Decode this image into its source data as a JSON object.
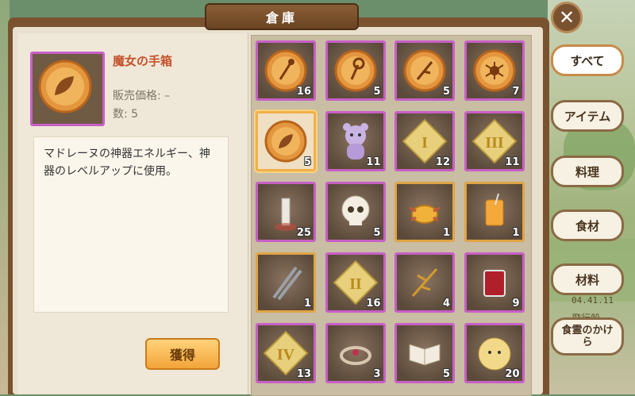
{
  "window": {
    "title": "倉庫"
  },
  "selected_item": {
    "name": "魔女の手箱",
    "price": "販売価格: –",
    "count": "数: 5",
    "description": "マドレーヌの神器エネルギー、神器のレベルアップに使用。",
    "obtain_label": "獲得"
  },
  "tabs": [
    {
      "label": "すべて",
      "active": true
    },
    {
      "label": "アイテム",
      "active": false
    },
    {
      "label": "料理",
      "active": false
    },
    {
      "label": "食材",
      "active": false
    },
    {
      "label": "材料",
      "active": false
    },
    {
      "label": "食霊のかけら",
      "active": false
    }
  ],
  "grid": [
    {
      "icon": "amber-orb-staff-icon",
      "qty": "16"
    },
    {
      "icon": "amber-orb-wand-icon",
      "qty": "5"
    },
    {
      "icon": "amber-orb-branch-icon",
      "qty": "5"
    },
    {
      "icon": "amber-orb-spider-icon",
      "qty": "7"
    },
    {
      "icon": "amber-orb-leaf-icon",
      "qty": "5"
    },
    {
      "icon": "purple-bear-toy-icon",
      "qty": "11"
    },
    {
      "icon": "puzzle-piece-one-icon",
      "qty": "12"
    },
    {
      "icon": "puzzle-piece-three-icon",
      "qty": "11"
    },
    {
      "icon": "bone-icon",
      "qty": "25"
    },
    {
      "icon": "skull-icon",
      "qty": "5"
    },
    {
      "icon": "golden-crab-icon",
      "qty": "1"
    },
    {
      "icon": "orange-drink-icon",
      "qty": "1"
    },
    {
      "icon": "chopsticks-icon",
      "qty": "1"
    },
    {
      "icon": "puzzle-piece-two-icon",
      "qty": "16"
    },
    {
      "icon": "golden-branch-icon",
      "qty": "4"
    },
    {
      "icon": "red-drink-glass-icon",
      "qty": "9"
    },
    {
      "icon": "puzzle-piece-four-icon",
      "qty": "13"
    },
    {
      "icon": "jeweled-ring-icon",
      "qty": "3"
    },
    {
      "icon": "open-book-icon",
      "qty": "5"
    },
    {
      "icon": "round-face-bun-icon",
      "qty": "20"
    }
  ],
  "background": {
    "map_text_1": "04.41.11",
    "map_text_2": "飛行船"
  },
  "colors": {
    "rare_border": "#c85fc6",
    "gold_border": "#e0a445",
    "accent": "#f3a43a"
  }
}
